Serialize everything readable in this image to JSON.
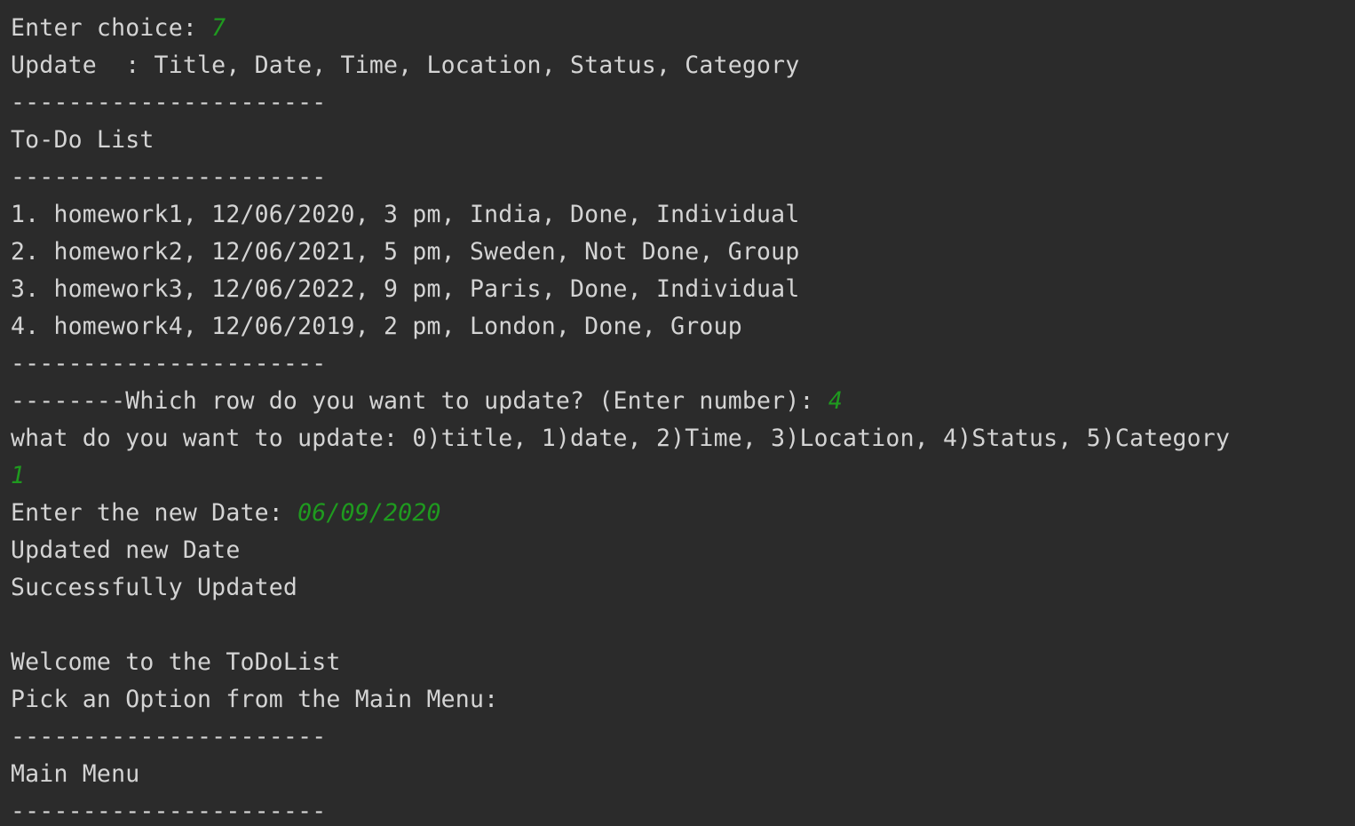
{
  "console": {
    "lines": [
      {
        "text": "Enter choice: ",
        "input": "7"
      },
      {
        "text": "Update  : Title, Date, Time, Location, Status, Category",
        "input": ""
      },
      {
        "text": "----------------------",
        "input": ""
      },
      {
        "text": "To-Do List",
        "input": ""
      },
      {
        "text": "----------------------",
        "input": ""
      },
      {
        "text": "1. homework1, 12/06/2020, 3 pm, India, Done, Individual",
        "input": ""
      },
      {
        "text": "2. homework2, 12/06/2021, 5 pm, Sweden, Not Done, Group",
        "input": ""
      },
      {
        "text": "3. homework3, 12/06/2022, 9 pm, Paris, Done, Individual",
        "input": ""
      },
      {
        "text": "4. homework4, 12/06/2019, 2 pm, London, Done, Group",
        "input": ""
      },
      {
        "text": "----------------------",
        "input": ""
      },
      {
        "text": "--------Which row do you want to update? (Enter number): ",
        "input": "4"
      },
      {
        "text": "what do you want to update: 0)title, 1)date, 2)Time, 3)Location, 4)Status, 5)Category",
        "input": ""
      },
      {
        "text": "",
        "input": "1"
      },
      {
        "text": "Enter the new Date: ",
        "input": "06/09/2020"
      },
      {
        "text": "Updated new Date",
        "input": ""
      },
      {
        "text": "Successfully Updated",
        "input": ""
      },
      {
        "text": "",
        "input": ""
      },
      {
        "text": "Welcome to the ToDoList",
        "input": ""
      },
      {
        "text": "Pick an Option from the Main Menu:",
        "input": ""
      },
      {
        "text": "----------------------",
        "input": ""
      },
      {
        "text": "Main Menu",
        "input": ""
      },
      {
        "text": "----------------------",
        "input": ""
      }
    ]
  }
}
